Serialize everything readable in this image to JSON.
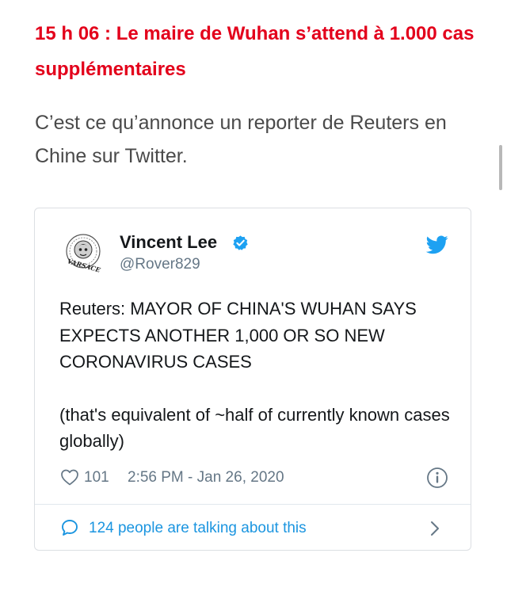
{
  "article": {
    "headline": "15 h 06 : Le maire de Wuhan s’attend à 1.000 cas supplémentaires",
    "body": "C’est ce qu’annonce un reporter de Reuters en Chine sur Twitter."
  },
  "tweet": {
    "author_name": "Vincent Lee",
    "handle": "@Rover829",
    "avatar_text": "VARSACE",
    "text_main": "Reuters: MAYOR OF CHINA'S WUHAN SAYS EXPECTS ANOTHER 1,000 OR SO NEW CORONAVIRUS CASES",
    "text_note": "(that's equivalent of ~half of currently known cases globally)",
    "likes": "101",
    "timestamp": "2:56 PM - Jan 26, 2020",
    "talking": "124 people are talking about this"
  },
  "colors": {
    "headline": "#e3001b",
    "twitter_blue": "#1da1f2",
    "link_blue": "#1b95e0",
    "muted": "#657786"
  },
  "icons": {
    "verified": "verified-badge-icon",
    "bird": "twitter-bird-icon",
    "heart": "heart-icon",
    "info": "info-icon",
    "bubble": "speech-bubble-icon",
    "chevron": "chevron-right-icon"
  }
}
